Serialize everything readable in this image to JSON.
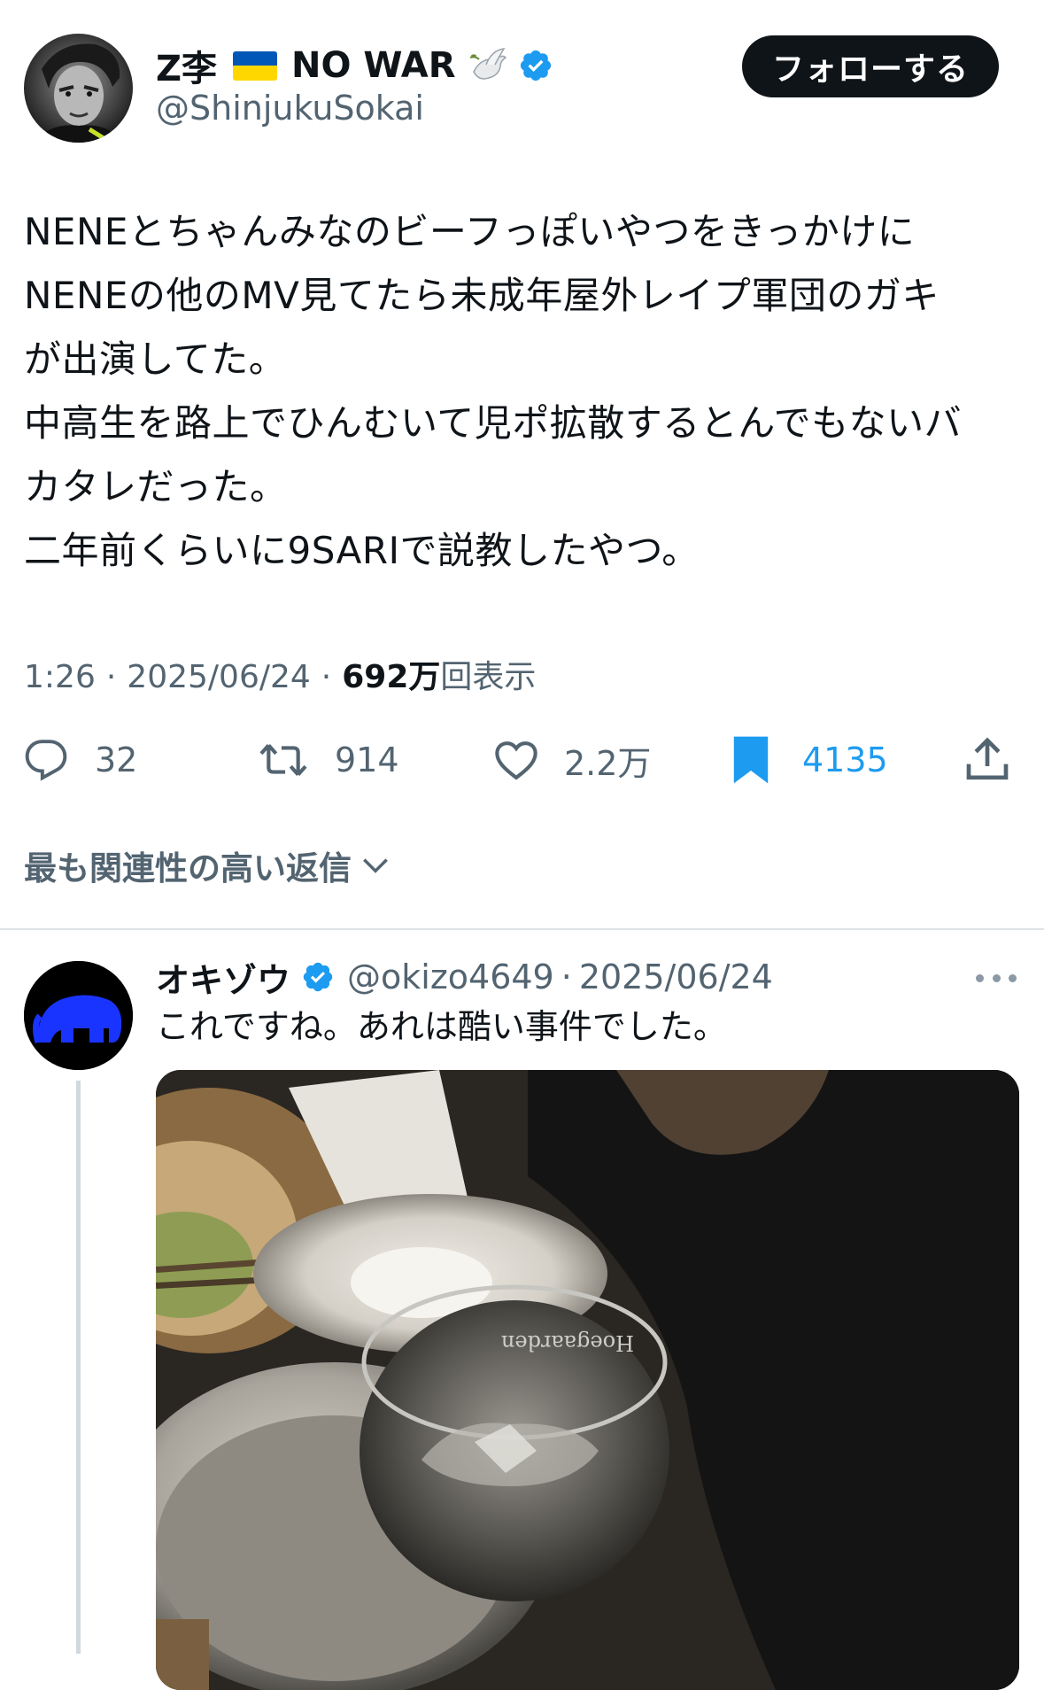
{
  "main_tweet": {
    "display_name": "Z李",
    "name_suffix": "NO WAR",
    "handle": "@ShinjukuSokai",
    "follow_label": "フォローする",
    "text": "NENEとちゃんみなのビーフっぽいやつをきっかけに\nNENEの他のMV見てたら未成年屋外レイプ軍団のガキ\nが出演してた。\n中高生を路上でひんむいて児ポ拡散するとんでもないバ\nカタレだった。\n二年前くらいに9SARIで説教したやつ。",
    "time": "1:26",
    "date": "2025/06/24",
    "sep": "·",
    "views": "692万",
    "views_suffix": "回表示"
  },
  "actions": {
    "replies": "32",
    "retweets": "914",
    "likes": "2.2万",
    "bookmarks": "4135"
  },
  "sort_label": "最も関連性の高い返信",
  "reply": {
    "name": "オキゾウ",
    "handle": "@okizo4649",
    "sep": "·",
    "date": "2025/06/24",
    "text": "これですね。あれは酷い事件でした。",
    "media_text": "Hoegaarden"
  },
  "colors": {
    "accent": "#1d9bf0",
    "text": "#0f1419",
    "secondary": "#536471"
  },
  "icons": {
    "verified": "verified-badge-icon",
    "dove": "dove-icon",
    "flag": "ukraine-flag-icon",
    "reply": "reply-bubble-icon",
    "retweet": "retweet-icon",
    "like": "heart-icon",
    "bookmark": "bookmark-filled-icon",
    "share": "share-icon",
    "chevron": "chevron-down-icon",
    "more": "more-dots-icon"
  }
}
